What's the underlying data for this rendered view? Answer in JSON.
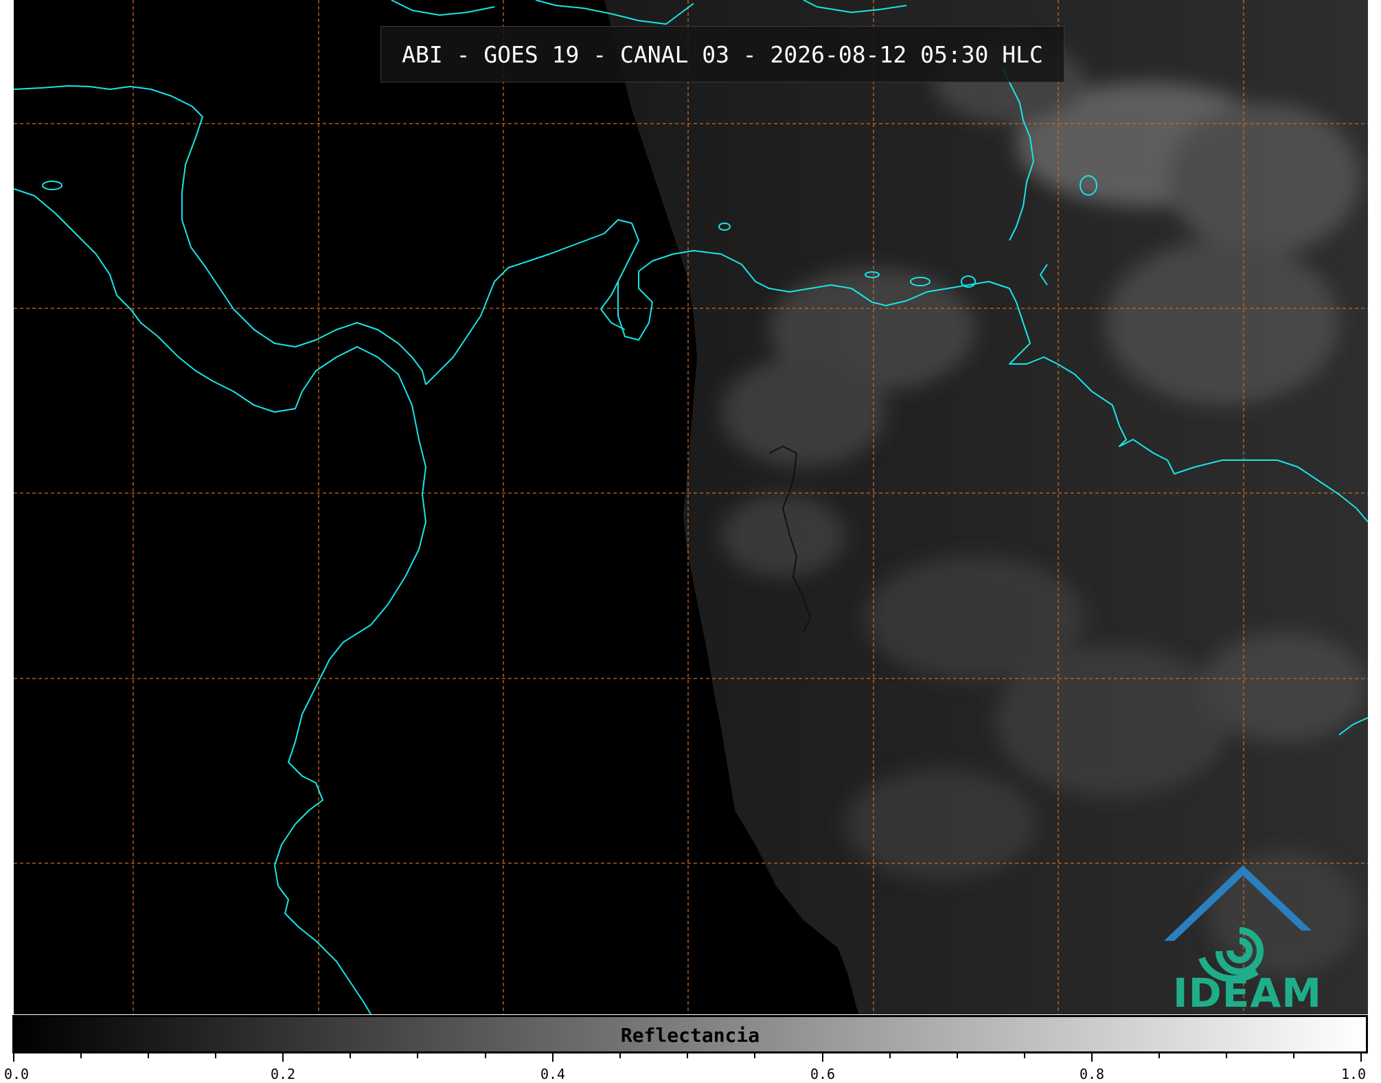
{
  "title": "ABI - GOES 19 - CANAL 03 - 2026-08-12 05:30 HLC",
  "logo": {
    "text": "IDEAM",
    "accent_color": "#1fae8a",
    "roof_color": "#2a7fbf"
  },
  "colorbar": {
    "label": "Reflectancia",
    "min": 0.0,
    "max": 1.0,
    "tick_labels": [
      "0.0",
      "0.2",
      "0.4",
      "0.6",
      "0.8",
      "1.0"
    ],
    "gradient": [
      "#000000",
      "#ffffff"
    ]
  },
  "map": {
    "coastline_color": "#19e6e6",
    "gridline_color": "#d2691e",
    "background": "#000000"
  }
}
